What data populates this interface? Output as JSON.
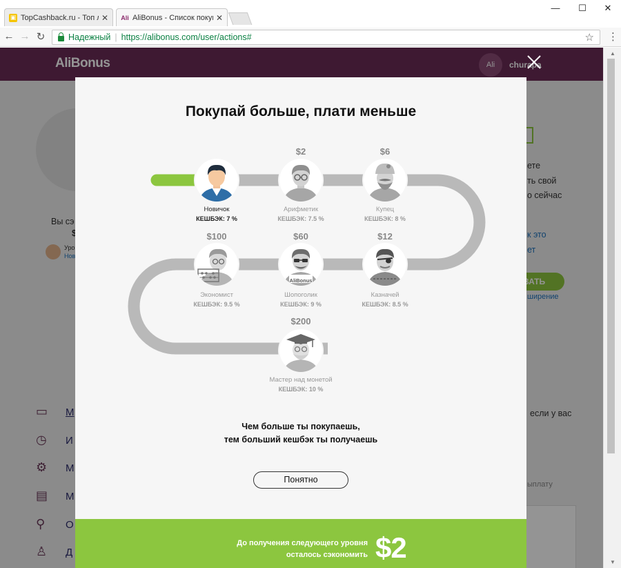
{
  "browser": {
    "tabs": [
      {
        "title": "TopCashback.ru - Топ лу",
        "active": false
      },
      {
        "title": "AliBonus - Список покуп",
        "active": true
      }
    ],
    "secure_label": "Надежный",
    "url": "https://alibonus.com/user/actions#"
  },
  "site": {
    "logo": "AliBonus",
    "avatar_text": "Ali",
    "user_name": "churapa",
    "bg_texts": {
      "savings_label": "Вы сэ",
      "savings_value": "$",
      "level_label": "Уро",
      "level_link": "Нов",
      "right1": "ете",
      "right2": "ть свой",
      "right3": "о сейчас",
      "right4": "к это",
      "right5": "ет",
      "green_btn": "ВАТЬ",
      "right6": "ширение",
      "right7": "если у вас",
      "right8": "ыплату"
    },
    "side_items": [
      "М",
      "И",
      "М",
      "М",
      "О",
      "Д"
    ]
  },
  "modal": {
    "title": "Покупай больше, плати меньше",
    "levels": [
      {
        "name": "Новичок",
        "cashback": "КЕШБЭК: 7 %",
        "price": "",
        "current": true
      },
      {
        "name": "Арифметик",
        "cashback": "КЕШБЭК: 7.5 %",
        "price": "$2",
        "current": false
      },
      {
        "name": "Купец",
        "cashback": "КЕШБЭК: 8 %",
        "price": "$6",
        "current": false
      },
      {
        "name": "Казначей",
        "cashback": "КЕШБЭК: 8.5 %",
        "price": "$12",
        "current": false
      },
      {
        "name": "Шопоголик",
        "cashback": "КЕШБЭК: 9 %",
        "price": "$60",
        "current": false
      },
      {
        "name": "Экономист",
        "cashback": "КЕШБЭК: 9.5 %",
        "price": "$100",
        "current": false
      },
      {
        "name": "Мастер над монетой",
        "cashback": "КЕШБЭК: 10 %",
        "price": "$200",
        "current": false
      }
    ],
    "shopaholic_badge": "AliBonus",
    "message_line1": "Чем больше ты покупаешь,",
    "message_line2": "тем больший кешбэк ты получаешь",
    "ok_button": "Понятно",
    "footer_line1": "До получения следующего уровня",
    "footer_line2": "осталось сэкономить",
    "footer_amount": "$2",
    "progress_fraction": 0.35
  },
  "colors": {
    "accent_green": "#8cc63f",
    "header_purple": "#6b2c57",
    "track_gray": "#b9b9b9"
  }
}
